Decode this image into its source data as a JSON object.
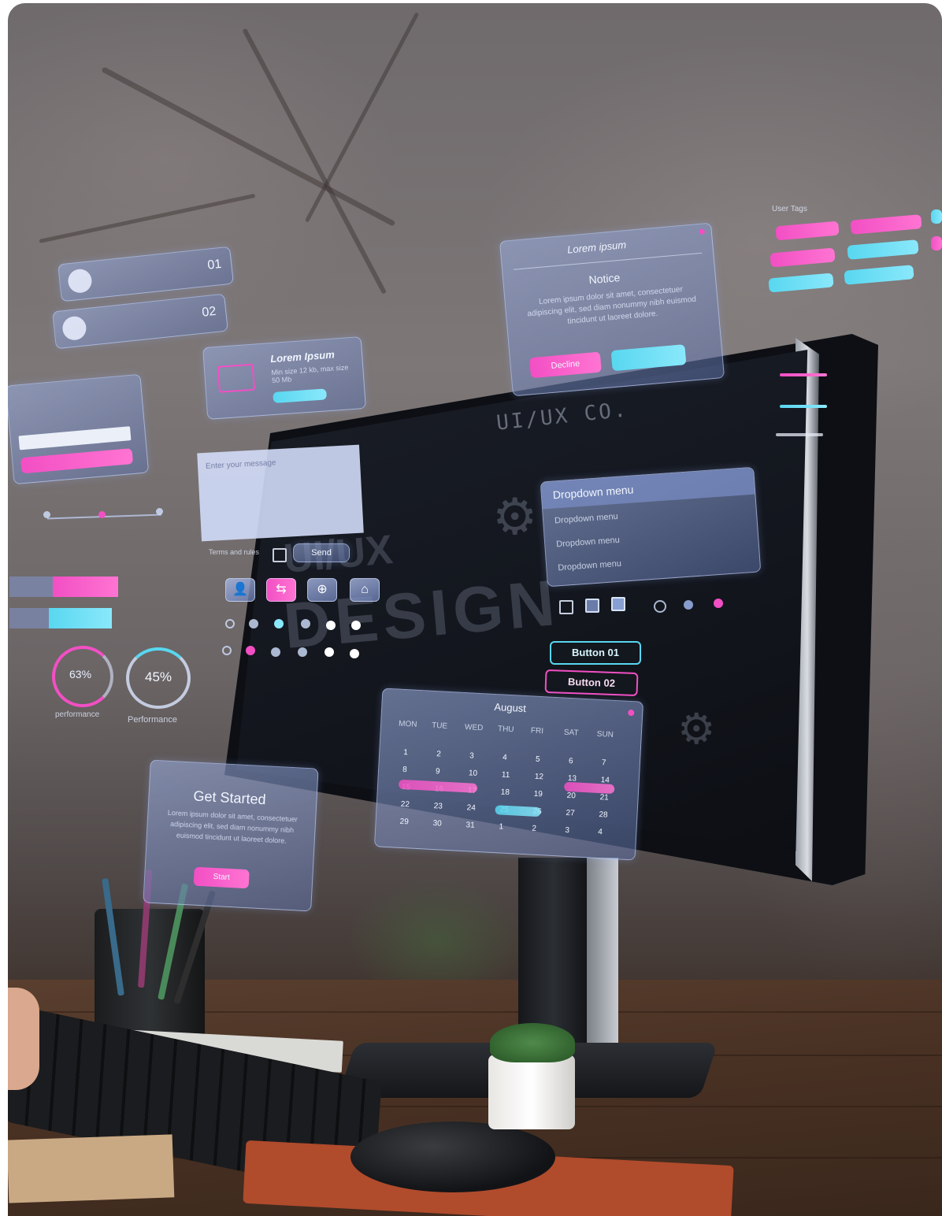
{
  "scene": {
    "monitor_brand": "UI/UX CO.",
    "screen_headline": "DESIGN",
    "screen_subheadline": "UI/UX"
  },
  "cards": {
    "list": {
      "item1_number": "01",
      "item2_number": "02"
    },
    "upload": {
      "title": "Lorem Ipsum",
      "subtitle": "Min size 12 kb, max size 50 Mb"
    },
    "notice": {
      "header": "Lorem ipsum",
      "title": "Notice",
      "body": "Lorem ipsum dolor sit amet, consectetuer adipiscing elit, sed diam nonummy nibh euismod tincidunt ut laoreet dolore.",
      "decline_label": "Decline"
    },
    "message": {
      "placeholder": "Enter your message",
      "terms_label": "Terms and rules",
      "send_label": "Send"
    },
    "dropdown": {
      "header": "Dropdown menu",
      "items": [
        "Dropdown menu",
        "Dropdown menu",
        "Dropdown menu"
      ]
    },
    "buttons": {
      "button1": "Button 01",
      "button2": "Button 02"
    },
    "calendar": {
      "month": "August",
      "weekdays": [
        "MON",
        "TUE",
        "WED",
        "THU",
        "FRI",
        "SAT",
        "SUN"
      ],
      "rows": [
        [
          "",
          "1",
          "2",
          "3",
          "4",
          "5",
          "6",
          "7"
        ],
        [
          "8",
          "9",
          "10",
          "11",
          "12",
          "13",
          "14"
        ],
        [
          "15",
          "16",
          "17",
          "18",
          "19",
          "20",
          "21"
        ],
        [
          "22",
          "23",
          "24",
          "25",
          "26",
          "27",
          "28"
        ],
        [
          "29",
          "30",
          "31",
          "1",
          "2",
          "3",
          "4"
        ]
      ]
    },
    "get_started": {
      "title": "Get Started",
      "body": "Lorem ipsum dolor sit amet, consectetuer adipiscing elit, sed diam nonummy nibh euismod tincidunt ut laoreet dolore.",
      "button": "Start"
    },
    "progress": {
      "ring1_value": "63%",
      "ring1_label": "performance",
      "ring2_value": "45%",
      "ring2_label": "Performance"
    },
    "tags": {
      "title": "User Tags"
    }
  },
  "colors": {
    "accent_pink": "#f24fc4",
    "accent_cyan": "#58d7f0",
    "card_tint": "#8a9fd6"
  }
}
